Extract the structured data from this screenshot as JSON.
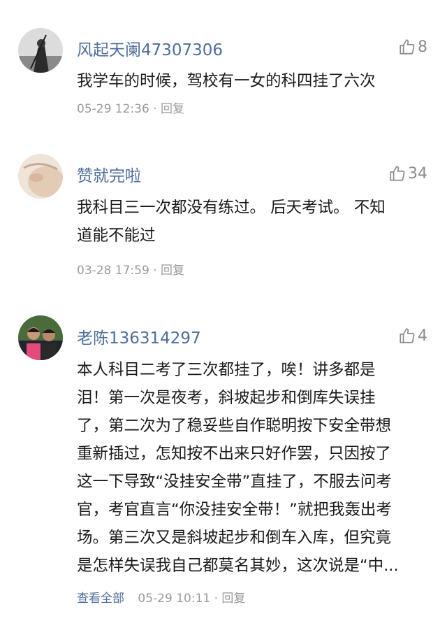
{
  "comments": [
    {
      "username": "风起天阑47307306",
      "likes": "8",
      "lines": [
        "我学车的时候，驾校有一女的科四挂了六次"
      ],
      "timestamp": "05-29 12:36",
      "reply": "· 回复"
    },
    {
      "username": "赞就完啦",
      "likes": "34",
      "lines": [
        "我科目三一次都没有练过。 后天考试。 不知",
        "道能不能过"
      ],
      "timestamp": "03-28 17:59",
      "reply": "· 回复"
    },
    {
      "username": "老陈136314297",
      "likes": "4",
      "lines": [
        "本人科目二考了三次都挂了，唉！讲多都是",
        "泪！第一次是夜考，斜坡起步和倒库失误挂",
        "了，第二次为了稳妥些自作聪明按下安全带想",
        "重新插过，怎知按不出来只好作罢，只因按了",
        "这一下导致“没挂安全带”直挂了，不服去问考",
        "官，考官直言“你没挂安全带！”就把我轰出考",
        "场。第三次又是斜坡起步和倒车入库，但究竟",
        "是怎样失误我自己都莫名其妙，这次说是“中..."
      ],
      "view_all": "查看全部",
      "timestamp": "05-29 10:11",
      "reply": "· 回复"
    }
  ],
  "icons": {
    "like": "thumbs-up-icon"
  },
  "colors": {
    "username": "#4f6e9c",
    "body_text": "#1a1a1a",
    "meta_text": "#9a9a9a",
    "like_icon": "#8c8c8c"
  }
}
